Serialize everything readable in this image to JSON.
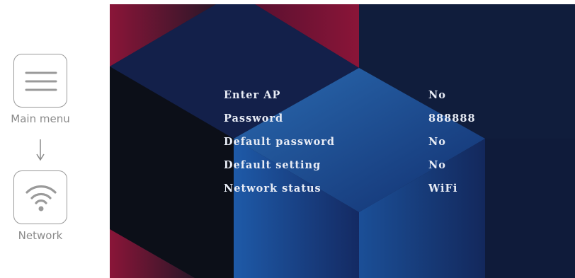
{
  "sidebar": {
    "items": [
      {
        "label": "Main menu",
        "icon": "hamburger-menu-icon"
      },
      {
        "label": "Network",
        "icon": "wifi-icon"
      }
    ],
    "arrow_icon": "down-arrow-icon"
  },
  "network_menu": {
    "rows": [
      {
        "label": "Enter AP",
        "value": "No"
      },
      {
        "label": "Password",
        "value": "888888"
      },
      {
        "label": "Default password",
        "value": "No"
      },
      {
        "label": "Default setting",
        "value": "No"
      },
      {
        "label": "Network status",
        "value": "WiFi"
      }
    ]
  },
  "colors": {
    "screen_bg": "#0f1b3a",
    "accent_crimson": "#8a1538",
    "accent_blue": "#1e5aa8",
    "text": "#e8ecf5"
  }
}
